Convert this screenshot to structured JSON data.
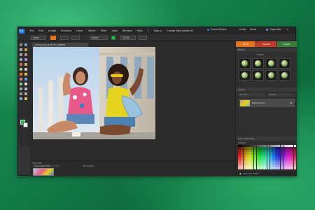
{
  "app": {
    "logo_text": "Pse"
  },
  "menubar": {
    "items": [
      "File",
      "Edit",
      "Image",
      "Enhance",
      "Layer",
      "Select",
      "Filter",
      "View",
      "Window",
      "Help"
    ],
    "sign_in": "Sign in",
    "create_link": "Create New Adobe ID",
    "share": "Guest Panels",
    "undo": "Undo",
    "redo": "Redo",
    "organizer": "Organizer",
    "home": "Home"
  },
  "optbar": {
    "open_label": "Open",
    "mode_label": "Mode",
    "zoom_label": "100%"
  },
  "document": {
    "tab_title": "untitled.jpg @ 66.7% (RGB/8)"
  },
  "right_panel": {
    "tabs": [
      "Quick",
      "Guided",
      "Expert"
    ],
    "effects_header": "Effects",
    "effects_label": "Artistic",
    "layers_header": "Layers",
    "layers_tabs": [
      "Normal",
      "Opacity"
    ],
    "layer_name": "Background",
    "swatches_header": "Color Swatches",
    "swatches_set": "Default"
  },
  "bin": {
    "header": "Photo Bin",
    "show_open": "Show Open Files",
    "bin_actions": "Bin Actions"
  },
  "status": {
    "tips": "Tips and Tricks"
  },
  "colors": {
    "accent_orange": "#e8741a",
    "accent_blue": "#2a7ae0",
    "tab_green": "#3a7d3a"
  }
}
